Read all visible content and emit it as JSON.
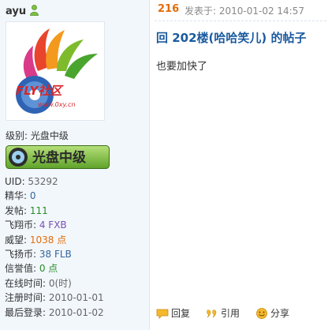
{
  "user": {
    "name": "ayu"
  },
  "avatar": {
    "brand_text": "FLY社区",
    "url_text": "www.0xy.cn"
  },
  "level": {
    "label": "级别: 光盘中级",
    "badge_text": "光盘中级"
  },
  "stats": [
    {
      "key": "UID: ",
      "value": "53292",
      "tone": "gray"
    },
    {
      "key": "精华: ",
      "value": "0",
      "tone": "blue"
    },
    {
      "key": "发帖: ",
      "value": "111",
      "tone": "green"
    },
    {
      "key": "飞翔币: ",
      "value": "4 FXB",
      "tone": "purple"
    },
    {
      "key": "威望: ",
      "value": "1038 点",
      "tone": "orange"
    },
    {
      "key": "飞扬币: ",
      "value": "38 FLB",
      "tone": "blue"
    },
    {
      "key": "信誉值: ",
      "value": "0 点",
      "tone": "green"
    },
    {
      "key": "在线时间: ",
      "value": "0(时)",
      "tone": "gray"
    },
    {
      "key": "注册时间: ",
      "value": "2010-01-01",
      "tone": "gray"
    },
    {
      "key": "最后登录: ",
      "value": "2010-01-02",
      "tone": "gray"
    }
  ],
  "post": {
    "floor": "216",
    "posted_at": "发表于: 2010-01-02 14:57",
    "title": "回  202楼(哈哈笑儿) 的帖子",
    "body": "也要加快了"
  },
  "actions": {
    "reply": "回复",
    "quote": "引用",
    "share": "分享"
  },
  "colors": {
    "title": "#1a5a9e",
    "floor": "#e36c0a",
    "sidebar_bg": "#f2f7fc"
  }
}
